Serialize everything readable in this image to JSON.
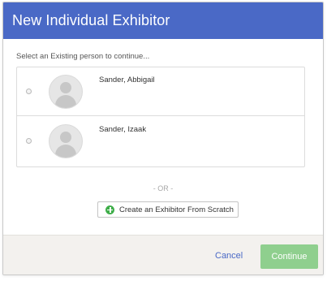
{
  "dialog": {
    "title": "New Individual Exhibitor",
    "instruction": "Select an Existing person to continue...",
    "people": [
      {
        "name": "Sander, Abbigail",
        "avatar_icon": "default-avatar-icon"
      },
      {
        "name": "Sander, Izaak",
        "avatar_icon": "default-avatar-icon"
      }
    ],
    "or_text": "- OR -",
    "scratch_button": {
      "label": "Create an Exhibitor From Scratch",
      "icon": "plus-circle-icon"
    },
    "cancel_label": "Cancel",
    "continue_label": "Continue"
  },
  "colors": {
    "header": "#4a69c6",
    "continue_button": "#8fcf8e",
    "plus_icon": "#3fae4a",
    "footer": "#f3f1ee"
  }
}
